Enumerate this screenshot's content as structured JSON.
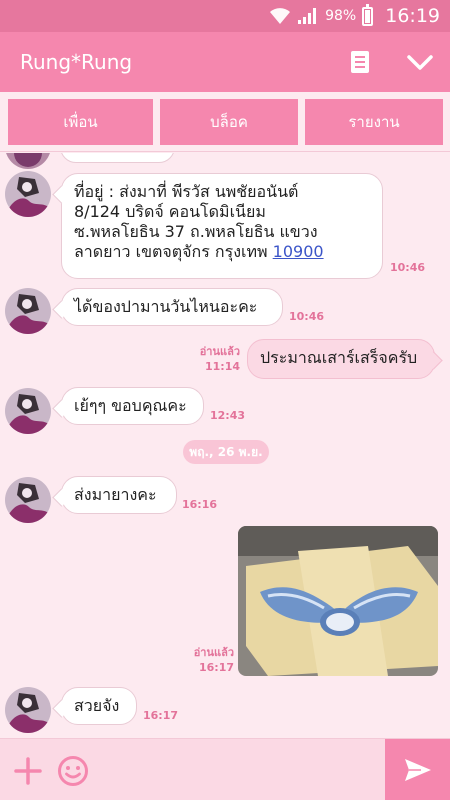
{
  "status": {
    "battery": "98%",
    "time": "16:19"
  },
  "header": {
    "title": "Rung*Rung"
  },
  "actions": [
    "เพื่อน",
    "บล็อค",
    "รายงาน"
  ],
  "messages": {
    "m1": {
      "line1": "ที่อยู่ : ส่งมาที่ พีรวัส นพชัยอนันต์",
      "line2": "8/124 บริดจ์ คอนโดมิเนียม",
      "line3": "ซ.พหลโยธิน 37 ถ.พหลโยธิน แขวง",
      "line4a": "ลาดยาว เขตจตุจักร กรุงเทพ",
      "link": "10900",
      "time": "10:46"
    },
    "m2": {
      "text": "ได้ของปามานวันไหนอะคะ",
      "time": "10:46"
    },
    "m3": {
      "text": "ประมาณเสาร์เสร็จครับ",
      "read": "อ่านแล้ว",
      "time": "11:14"
    },
    "m4": {
      "text": "เย้ๆๆ ขอบคุณคะ",
      "time": "12:43"
    },
    "date": "พฤ., 26 พ.ย.",
    "m5": {
      "text": "ส่งมายางคะ",
      "time": "16:16"
    },
    "m6": {
      "read": "อ่านแล้ว",
      "time": "16:17"
    },
    "m7": {
      "text": "สวยจัง",
      "time": "16:17"
    }
  },
  "colors": {
    "header": "#f587ae",
    "statusbar": "#e6779e",
    "background": "#fdeaf0",
    "accent_text": "#e3739a"
  },
  "icons": {
    "notes": "notes-icon",
    "collapse": "chevron-down-icon",
    "add": "plus-icon",
    "emoji": "emoji-icon",
    "send": "send-icon"
  }
}
